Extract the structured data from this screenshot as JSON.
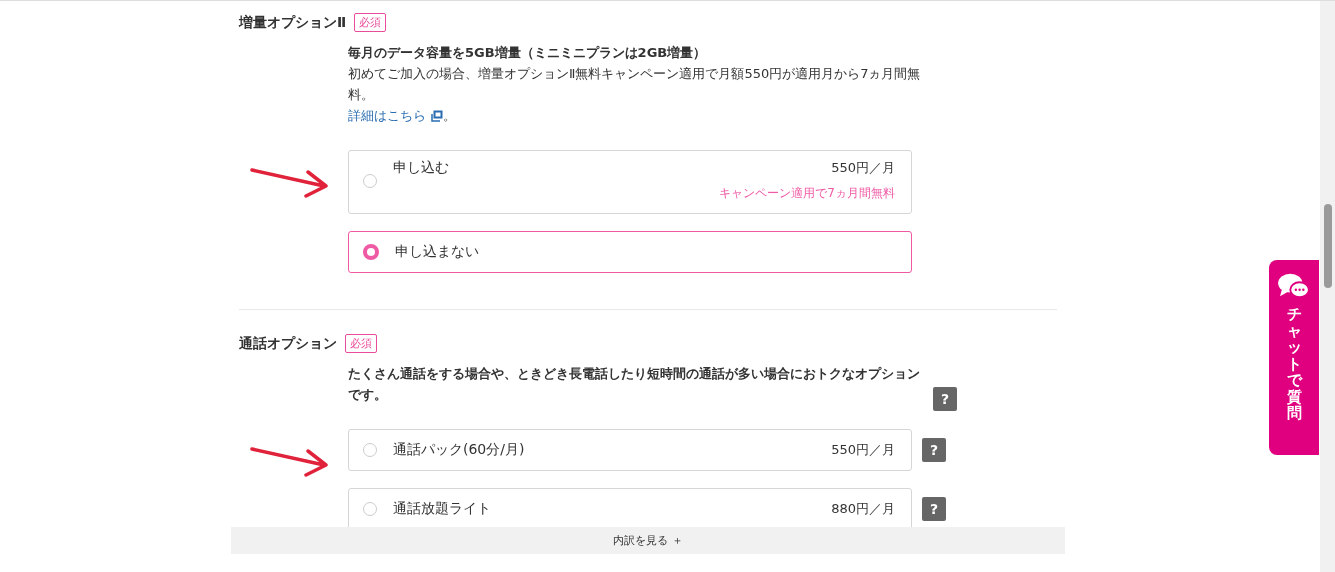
{
  "sections": [
    {
      "title": "増量オプションⅡ",
      "badge": "必須",
      "lead": "毎月のデータ容量を5GB増量（ミニミニプランは2GB増量）",
      "body": "初めてご加入の場合、増量オプションⅡ無料キャンペーン適用で月額550円が適用月から7ヵ月間無料。",
      "link": "詳細はこちら",
      "link_suffix": "。",
      "options": [
        {
          "label": "申し込む",
          "price": "550円／月",
          "note": "キャンペーン適用で7ヵ月間無料",
          "selected": false
        },
        {
          "label": "申し込まない",
          "selected": true
        }
      ]
    },
    {
      "title": "通話オプション",
      "badge": "必須",
      "lead": "たくさん通話をする場合や、ときどき長電話したり短時間の通話が多い場合におトクなオプションです。",
      "lead_help": true,
      "options": [
        {
          "label": "通話パック(60分/月)",
          "price": "550円／月",
          "selected": false,
          "help": true
        },
        {
          "label": "通話放題ライト",
          "price": "880円／月",
          "selected": false,
          "help": true
        }
      ]
    }
  ],
  "help_label": "?",
  "breakdown": {
    "label": "内訳を見る",
    "icon": "＋"
  },
  "chat": {
    "label": "チャットで質問"
  }
}
